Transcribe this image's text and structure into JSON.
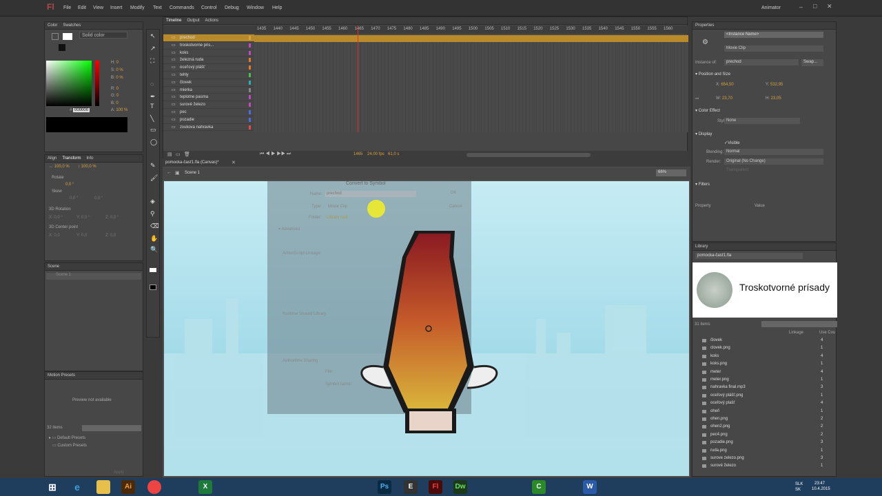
{
  "app": {
    "logo": "Fl",
    "workspace": "Animator"
  },
  "menu": [
    "File",
    "Edit",
    "View",
    "Insert",
    "Modify",
    "Text",
    "Commands",
    "Control",
    "Debug",
    "Window",
    "Help"
  ],
  "color_panel": {
    "tabs": [
      "Color",
      "Swatches"
    ],
    "type": "Solid color",
    "hsb": {
      "H": "0",
      "S": "0 %",
      "B": "0 %"
    },
    "rgb": {
      "R": "0",
      "G": "0",
      "B": "0"
    },
    "alpha": "100 %",
    "hex": "000000"
  },
  "transform_panel": {
    "tabs": [
      "Align",
      "Transform",
      "Info"
    ],
    "width": "100,0 %",
    "height": "100,0 %",
    "rotate_label": "Rotate",
    "rotate": "0,0 °",
    "skew_label": "Skew",
    "skew1": "0,0 °",
    "skew2": "0,0 °",
    "rot3d": "3D Rotation",
    "x3": "0,0 °",
    "y3": "0,0 °",
    "z3": "0,0 °",
    "center3d": "3D Center point",
    "cx": "0,0",
    "cy": "0,0",
    "cz": "0,0"
  },
  "scene_panel": {
    "title": "Scene",
    "item": "Scene 1"
  },
  "motion_presets": {
    "title": "Motion Presets",
    "preview": "Preview not available",
    "count": "32 items",
    "folders": [
      "Default Presets",
      "Custom Presets"
    ],
    "apply": "Apply"
  },
  "timeline": {
    "tabs": [
      "Timeline",
      "Output",
      "Actions"
    ],
    "frames": [
      "1435",
      "1440",
      "1445",
      "1450",
      "1455",
      "1460",
      "1465",
      "1470",
      "1475",
      "1480",
      "1485",
      "1490",
      "1495",
      "1500",
      "1505",
      "1510",
      "1515",
      "1520",
      "1525",
      "1530",
      "1535",
      "1540",
      "1545",
      "1550",
      "1555",
      "1560"
    ],
    "layers": [
      "prechod",
      "troskotvorne pris...",
      "koks",
      "železná ruda",
      "ocel'ový plášť",
      "tehly",
      "človek",
      "mierka",
      "teplotne pasma",
      "surové železo",
      "pec",
      "pozadie",
      "zvukova nahravka"
    ],
    "current_frame": "1465",
    "fps": "24,00 fps",
    "time": "61,0 s"
  },
  "stage": {
    "doc_tab": "pomocka-časť1.fla (Canvas)*",
    "scene": "Scene 1",
    "zoom": "66%"
  },
  "dialog": {
    "title": "Convert to Symbol",
    "name_label": "Name:",
    "name_value": "prechod",
    "type_label": "Type:",
    "type_value": "Movie Clip",
    "folder_label": "Folder:",
    "folder_value": "Library root",
    "ok": "OK",
    "cancel": "Cancel",
    "advanced": "Advanced",
    "as_linkage": "ActionScript Linkage",
    "rsl": "Runtime Shared Library",
    "authortime": "Authortime Sharing",
    "file": "File:",
    "symbol_name": "Symbol name:"
  },
  "properties": {
    "title": "Properties",
    "instance_name": "<Instance Name>",
    "type": "Movie Clip",
    "instance_of_label": "Instance of:",
    "instance_of": "prechod",
    "swap": "Swap...",
    "pos_size": "Position and Size",
    "x": "654,50",
    "y": "532,95",
    "w": "23,70",
    "h": "23,05",
    "color_effect": "Color Effect",
    "style_label": "Style:",
    "style": "None",
    "display": "Display",
    "visible": "Visible",
    "blending_label": "Blending:",
    "blending": "Normal",
    "render_label": "Render:",
    "render": "Original (No Change)",
    "transparent": "Transparent",
    "filters": "Filters",
    "prop_col": "Property",
    "value_col": "Value"
  },
  "library": {
    "title": "Library",
    "file": "pomocka-časť1.fla",
    "preview_text": "Troskotvorné prísady",
    "count": "31 items",
    "col_linkage": "Linkage",
    "col_use": "Use Cou",
    "items": [
      {
        "n": "človek",
        "c": "4"
      },
      {
        "n": "clovek.png",
        "c": "1"
      },
      {
        "n": "koks",
        "c": "4"
      },
      {
        "n": "koks.png",
        "c": "1"
      },
      {
        "n": "meter",
        "c": "4"
      },
      {
        "n": "meter.png",
        "c": "1"
      },
      {
        "n": "nahravka final.mp3",
        "c": "3"
      },
      {
        "n": "oceľový plášť.png",
        "c": "1"
      },
      {
        "n": "oceľový plašť",
        "c": "4"
      },
      {
        "n": "oheň",
        "c": "1"
      },
      {
        "n": "ohen.png",
        "c": "2"
      },
      {
        "n": "ohen2.png",
        "c": "2"
      },
      {
        "n": "pec4.png",
        "c": "2"
      },
      {
        "n": "pozadie.png",
        "c": "3"
      },
      {
        "n": "ruda.png",
        "c": "1"
      },
      {
        "n": "surove zelezo.png",
        "c": "3"
      },
      {
        "n": "surové železo",
        "c": "1"
      }
    ]
  },
  "tray": {
    "lang": "SLK\nSK",
    "time": "23:47",
    "date": "10.4.2015"
  },
  "colors": {
    "accent": "#d9a43c",
    "stage_bg": "#a8e0ee",
    "taskbar": "#1f3d5c"
  }
}
